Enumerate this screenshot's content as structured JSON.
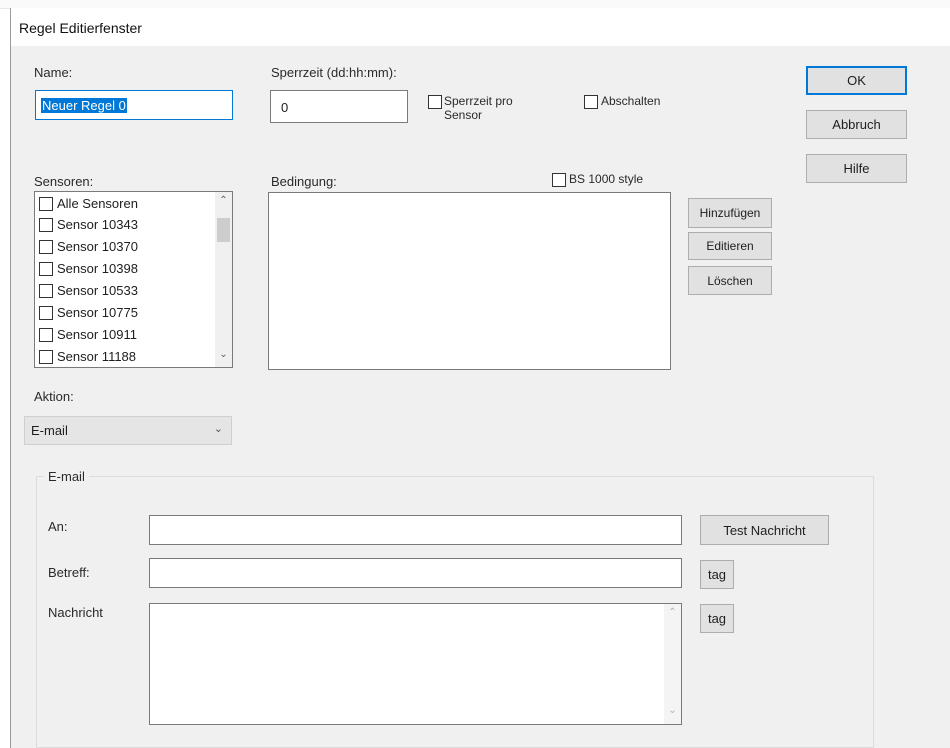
{
  "window": {
    "title": "Regel Editierfenster"
  },
  "name": {
    "label": "Name:",
    "value": "Neuer Regel 0"
  },
  "sperrzeit": {
    "label": "Sperrzeit (dd:hh:mm):",
    "value": "0",
    "per_sensor_label": "Sperrzeit pro Sensor",
    "abschalten_label": "Abschalten"
  },
  "buttons": {
    "ok": "OK",
    "abbruch": "Abbruch",
    "hilfe": "Hilfe",
    "hinzufuegen": "Hinzufügen",
    "editieren": "Editieren",
    "loeschen": "Löschen",
    "test_nachricht": "Test Nachricht",
    "tag1": "tag",
    "tag2": "tag"
  },
  "sensoren": {
    "label": "Sensoren:",
    "items": [
      "Alle Sensoren",
      "Sensor 10343",
      "Sensor 10370",
      "Sensor 10398",
      "Sensor 10533",
      "Sensor 10775",
      "Sensor 10911",
      "Sensor 11188"
    ]
  },
  "bedingung": {
    "label": "Bedingung:",
    "bs1000_label": "BS 1000 style"
  },
  "aktion": {
    "label": "Aktion:",
    "value": "E-mail"
  },
  "email": {
    "group_label": "E-mail",
    "an_label": "An:",
    "betreff_label": "Betreff:",
    "nachricht_label": "Nachricht"
  },
  "colors": {
    "accent": "#0078d7",
    "dialog_bg": "#f0f0f0",
    "button_bg": "#e1e1e1"
  }
}
